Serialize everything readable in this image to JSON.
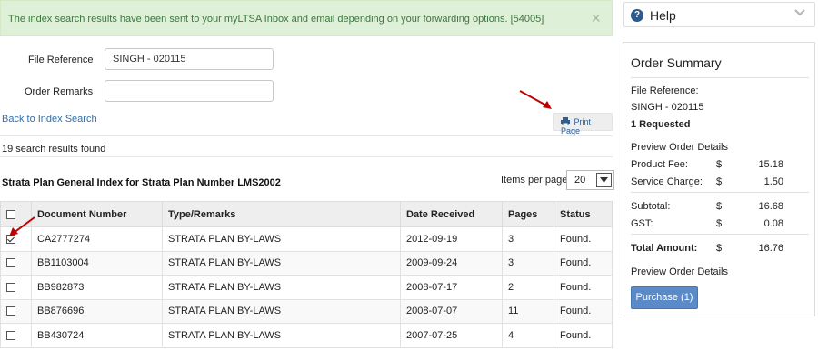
{
  "alert": {
    "message": "The index search results have been sent to your myLTSA Inbox and email depending on your forwarding options. [54005]",
    "close_glyph": "×"
  },
  "form": {
    "file_reference_label": "File Reference",
    "file_reference_value": "SINGH - 020115",
    "order_remarks_label": "Order Remarks",
    "order_remarks_value": ""
  },
  "back_link": "Back to Index Search",
  "print_button": "Print Page",
  "results_count": "19 search results found",
  "section_title": "Strata Plan General Index for Strata Plan Number LMS2002",
  "items_per_page": {
    "label": "Items per page",
    "value": "20"
  },
  "table": {
    "headers": [
      "Document Number",
      "Type/Remarks",
      "Date Received",
      "Pages",
      "Status"
    ],
    "rows": [
      {
        "checked": true,
        "doc": "CA2777274",
        "type": "STRATA PLAN BY-LAWS",
        "date": "2012-09-19",
        "pages": "3",
        "status": "Found."
      },
      {
        "checked": false,
        "doc": "BB1103004",
        "type": "STRATA PLAN BY-LAWS",
        "date": "2009-09-24",
        "pages": "3",
        "status": "Found."
      },
      {
        "checked": false,
        "doc": "BB982873",
        "type": "STRATA PLAN BY-LAWS",
        "date": "2008-07-17",
        "pages": "2",
        "status": "Found."
      },
      {
        "checked": false,
        "doc": "BB876696",
        "type": "STRATA PLAN BY-LAWS",
        "date": "2008-07-07",
        "pages": "11",
        "status": "Found."
      },
      {
        "checked": false,
        "doc": "BB430724",
        "type": "STRATA PLAN BY-LAWS",
        "date": "2007-07-25",
        "pages": "4",
        "status": "Found."
      }
    ]
  },
  "help": {
    "label": "Help",
    "icon": "question-circle-icon"
  },
  "summary": {
    "title": "Order Summary",
    "file_ref_label": "File Reference:",
    "file_ref_value": "SINGH - 020115",
    "requested": "1 Requested",
    "preview_link": "Preview Order Details",
    "product_fee_label": "Product Fee:",
    "product_fee": "15.18",
    "service_charge_label": "Service Charge:",
    "service_charge": "1.50",
    "subtotal_label": "Subtotal:",
    "subtotal": "16.68",
    "gst_label": "GST:",
    "gst": "0.08",
    "total_label": "Total Amount:",
    "total": "16.76",
    "currency": "$",
    "purchase_button": "Purchase (1)"
  },
  "colors": {
    "alert_bg": "#dff0d8",
    "alert_text": "#3c763d",
    "link": "#2f6fad",
    "purchase_bg": "#5b8ac9",
    "annotation_arrow": "#c00000"
  }
}
